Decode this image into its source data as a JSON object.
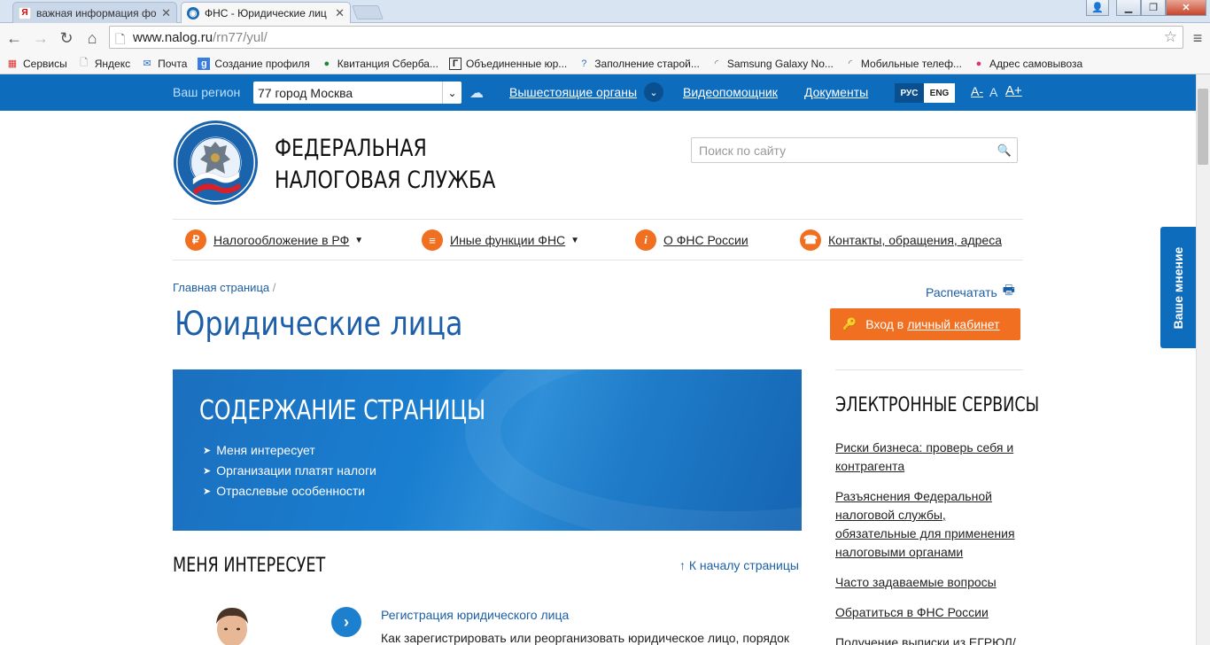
{
  "browser": {
    "tabs": [
      {
        "title": "важная информация фо",
        "favicon": "yandex-icon"
      },
      {
        "title": "ФНС - Юридические лиц",
        "favicon": "fns-icon"
      }
    ],
    "url_host": "www.nalog.ru",
    "url_path": "/rn77/yul/",
    "bookmarks": [
      {
        "label": "Сервисы",
        "icon": "apps-icon"
      },
      {
        "label": "Яндекс",
        "icon": "page-icon"
      },
      {
        "label": "Почта",
        "icon": "mail-icon"
      },
      {
        "label": "Создание профиля",
        "icon": "google-icon"
      },
      {
        "label": "Квитанция Сберба...",
        "icon": "sberbank-icon"
      },
      {
        "label": "Объединенные юр...",
        "icon": "doc-icon"
      },
      {
        "label": "Заполнение старой...",
        "icon": "question-icon"
      },
      {
        "label": "Samsung Galaxy No...",
        "icon": "loading-icon"
      },
      {
        "label": "Мобильные телеф...",
        "icon": "loading-icon"
      },
      {
        "label": "Адрес самовывоза",
        "icon": "apple-icon"
      }
    ]
  },
  "topbar": {
    "region_label": "Ваш регион",
    "region_value": "77 город Москва",
    "links": [
      "Вышестоящие органы",
      "Видеопомощник",
      "Документы"
    ],
    "lang_ru": "РУС",
    "lang_en": "ENG",
    "font_sizes": [
      "A-",
      "A",
      "A+"
    ]
  },
  "header": {
    "brand_line1": "ФЕДЕРАЛЬНАЯ",
    "brand_line2": "НАЛОГОВАЯ СЛУЖБА",
    "search_placeholder": "Поиск по сайту",
    "logo_text": "ФЕДЕРАЛЬНАЯ НАЛОГОВАЯ СЛУЖБА"
  },
  "menu": [
    {
      "label": "Налогообложение в РФ",
      "icon": "ruble-icon",
      "has_dropdown": true
    },
    {
      "label": "Иные функции ФНС",
      "icon": "list-icon",
      "has_dropdown": true
    },
    {
      "label": "О ФНС России",
      "icon": "info-icon",
      "has_dropdown": false
    },
    {
      "label": "Контакты, обращения, адреса",
      "icon": "phone-icon",
      "has_dropdown": false
    }
  ],
  "breadcrumb": "Главная страница",
  "breadcrumb_sep": "/",
  "print_label": "Распечатать",
  "page_title": "Юридические лица",
  "cabinet": {
    "prefix": "Вход в",
    "link": "личный кабинет"
  },
  "banner": {
    "title": "СОДЕРЖАНИЕ СТРАНИЦЫ",
    "items": [
      "Меня интересует",
      "Организации платят налоги",
      "Отраслевые особенности"
    ]
  },
  "services": {
    "title": "ЭЛЕКТРОННЫЕ СЕРВИСЫ",
    "items": [
      "Риски бизнеса: проверь себя и контрагента",
      "Разъяснения Федеральной налоговой службы, обязательные для применения налоговыми органами",
      "Часто задаваемые вопросы",
      "Обратиться в ФНС России",
      "Получение выписки из ЕГРЮЛ/"
    ]
  },
  "interest": {
    "title": "МЕНЯ ИНТЕРЕСУЕТ",
    "to_top": "↑ К началу страницы",
    "reg_title": "Регистрация юридического лица",
    "reg_desc": "Как зарегистрировать или реорганизовать юридическое лицо, порядок"
  },
  "feedback": "Ваше мнение",
  "colors": {
    "brand_blue": "#0e6cbc",
    "accent_orange": "#f16f21",
    "link_blue": "#1b5fa5"
  }
}
